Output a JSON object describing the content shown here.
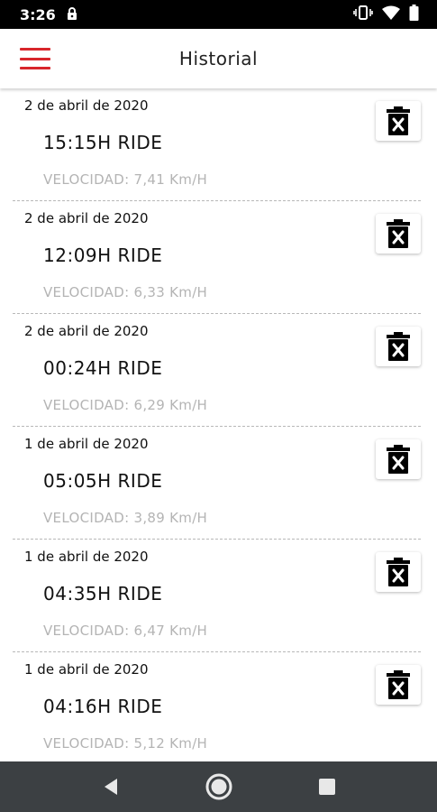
{
  "status_bar": {
    "time": "3:26",
    "icons": [
      "lock-icon",
      "vibrate-icon",
      "wifi-icon",
      "battery-icon"
    ]
  },
  "header": {
    "title": "Historial",
    "menu_icon": "hamburger-menu-icon",
    "accent_color": "#d8262b"
  },
  "rides": [
    {
      "date": "2 de abril de 2020",
      "title": "15:15H RIDE",
      "speed": "VELOCIDAD: 7,41 Km/H"
    },
    {
      "date": "2 de abril de 2020",
      "title": "12:09H RIDE",
      "speed": "VELOCIDAD: 6,33 Km/H"
    },
    {
      "date": "2 de abril de 2020",
      "title": "00:24H RIDE",
      "speed": "VELOCIDAD: 6,29 Km/H"
    },
    {
      "date": "1 de abril de 2020",
      "title": "05:05H RIDE",
      "speed": "VELOCIDAD: 3,89 Km/H"
    },
    {
      "date": "1 de abril de 2020",
      "title": "04:35H RIDE",
      "speed": "VELOCIDAD: 6,47 Km/H"
    },
    {
      "date": "1 de abril de 2020",
      "title": "04:16H RIDE",
      "speed": "VELOCIDAD: 5,12 Km/H"
    }
  ],
  "delete_icon": "delete-bin-icon",
  "nav_bar": {
    "icons": [
      "back-icon",
      "home-icon",
      "recents-icon"
    ],
    "background": "#3c4043"
  }
}
